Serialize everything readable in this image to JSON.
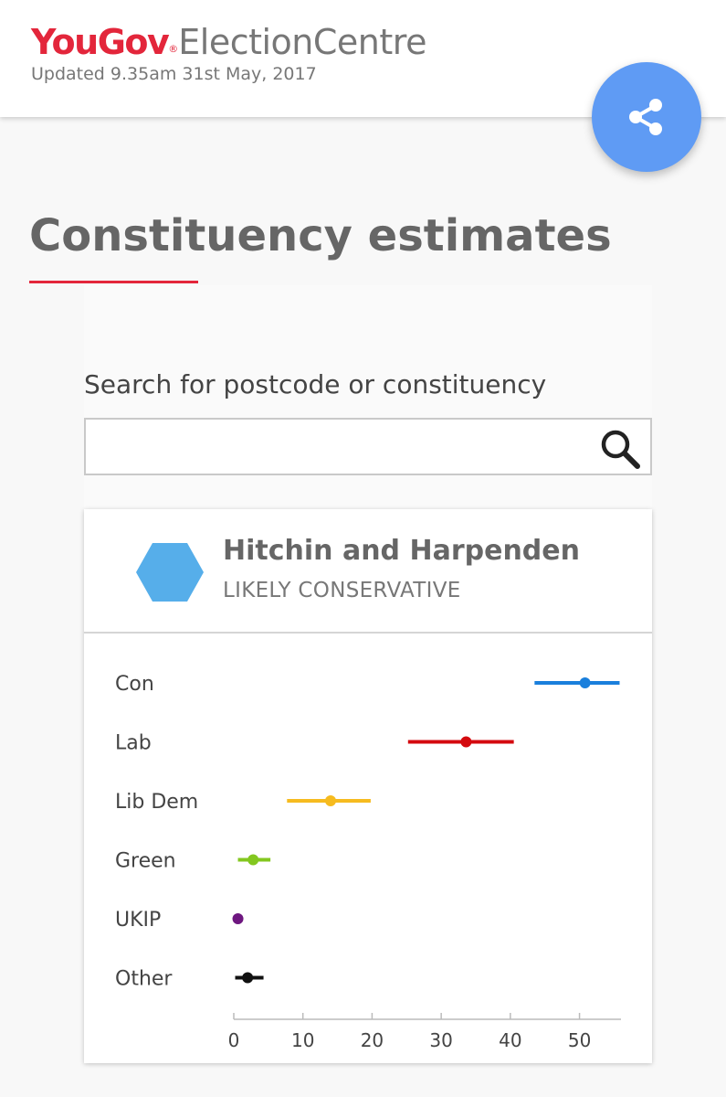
{
  "header": {
    "brand_you": "You",
    "brand_gov": "Gov",
    "brand_reg": "®",
    "brand_suffix": "ElectionCentre",
    "updated": "Updated 9.35am 31st May, 2017",
    "share_icon": "share-icon"
  },
  "page": {
    "title": "Constituency estimates"
  },
  "search": {
    "label": "Search for postcode or constituency",
    "value": "",
    "placeholder": "",
    "icon": "magnifier-icon"
  },
  "constituency": {
    "name": "Hitchin and Harpenden",
    "status": "LIKELY CONSERVATIVE",
    "hex_color": "#56aeea"
  },
  "chart_data": {
    "type": "scatter",
    "title": "",
    "xlabel": "",
    "ylabel": "",
    "xlim": [
      0,
      56
    ],
    "xticks": [
      0,
      10,
      20,
      30,
      40,
      50
    ],
    "grid": false,
    "categories": [
      "Con",
      "Lab",
      "Lib Dem",
      "Green",
      "UKIP",
      "Other"
    ],
    "series": [
      {
        "party": "Con",
        "estimate": 50.8,
        "low": 43.5,
        "high": 55.8,
        "color": "#1a7fdc"
      },
      {
        "party": "Lab",
        "estimate": 33.6,
        "low": 25.2,
        "high": 40.5,
        "color": "#d40a0f"
      },
      {
        "party": "Lib Dem",
        "estimate": 14.0,
        "low": 7.7,
        "high": 19.8,
        "color": "#f6bb1f"
      },
      {
        "party": "Green",
        "estimate": 2.8,
        "low": 0.6,
        "high": 5.3,
        "color": "#83c71f"
      },
      {
        "party": "UKIP",
        "estimate": 0.6,
        "low": 0.6,
        "high": 0.6,
        "color": "#6e1780"
      },
      {
        "party": "Other",
        "estimate": 2.0,
        "low": 0.2,
        "high": 4.3,
        "color": "#111111"
      }
    ]
  }
}
